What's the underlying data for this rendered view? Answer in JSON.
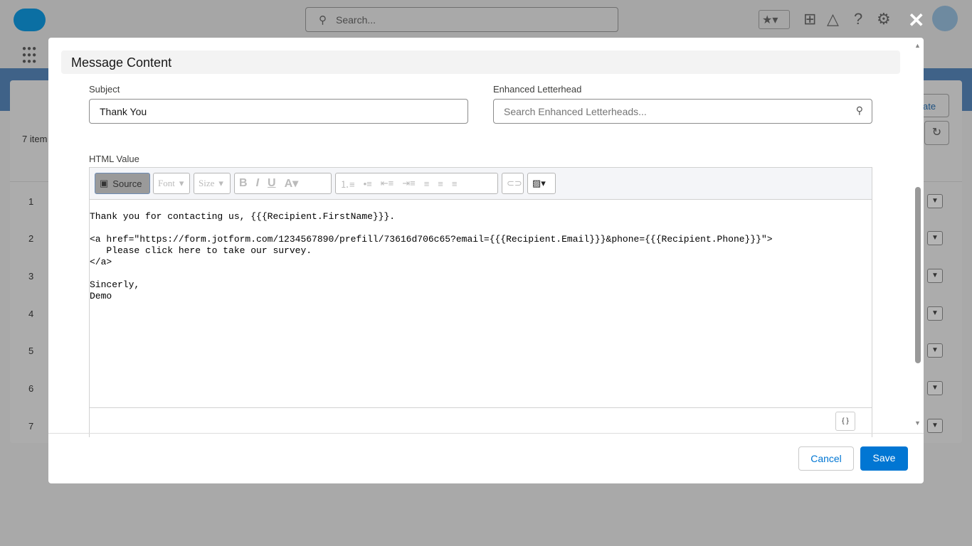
{
  "header": {
    "search_placeholder": "Search..."
  },
  "background": {
    "item_count": "7 item",
    "button_partial": "ate",
    "rows": [
      "1",
      "2",
      "3",
      "4",
      "5",
      "6",
      "7"
    ]
  },
  "modal": {
    "section_title": "Message Content",
    "subject": {
      "label": "Subject",
      "value": "Thank You"
    },
    "letterhead": {
      "label": "Enhanced Letterhead",
      "placeholder": "Search Enhanced Letterheads..."
    },
    "html_value": {
      "label": "HTML Value",
      "toolbar": {
        "source": "Source",
        "font": "Font",
        "size": "Size"
      },
      "content": "Thank you for contacting us, {{{Recipient.FirstName}}}.\n\n<a href=\"https://form.jotform.com/1234567890/prefill/73616d706c65?email={{{Recipient.Email}}}&phone={{{Recipient.Phone}}}\">\n   Please click here to take our survey.\n</a>\n\nSincerly,\nDemo",
      "merge_fields": "{ }"
    },
    "cancel": "Cancel",
    "save": "Save"
  }
}
